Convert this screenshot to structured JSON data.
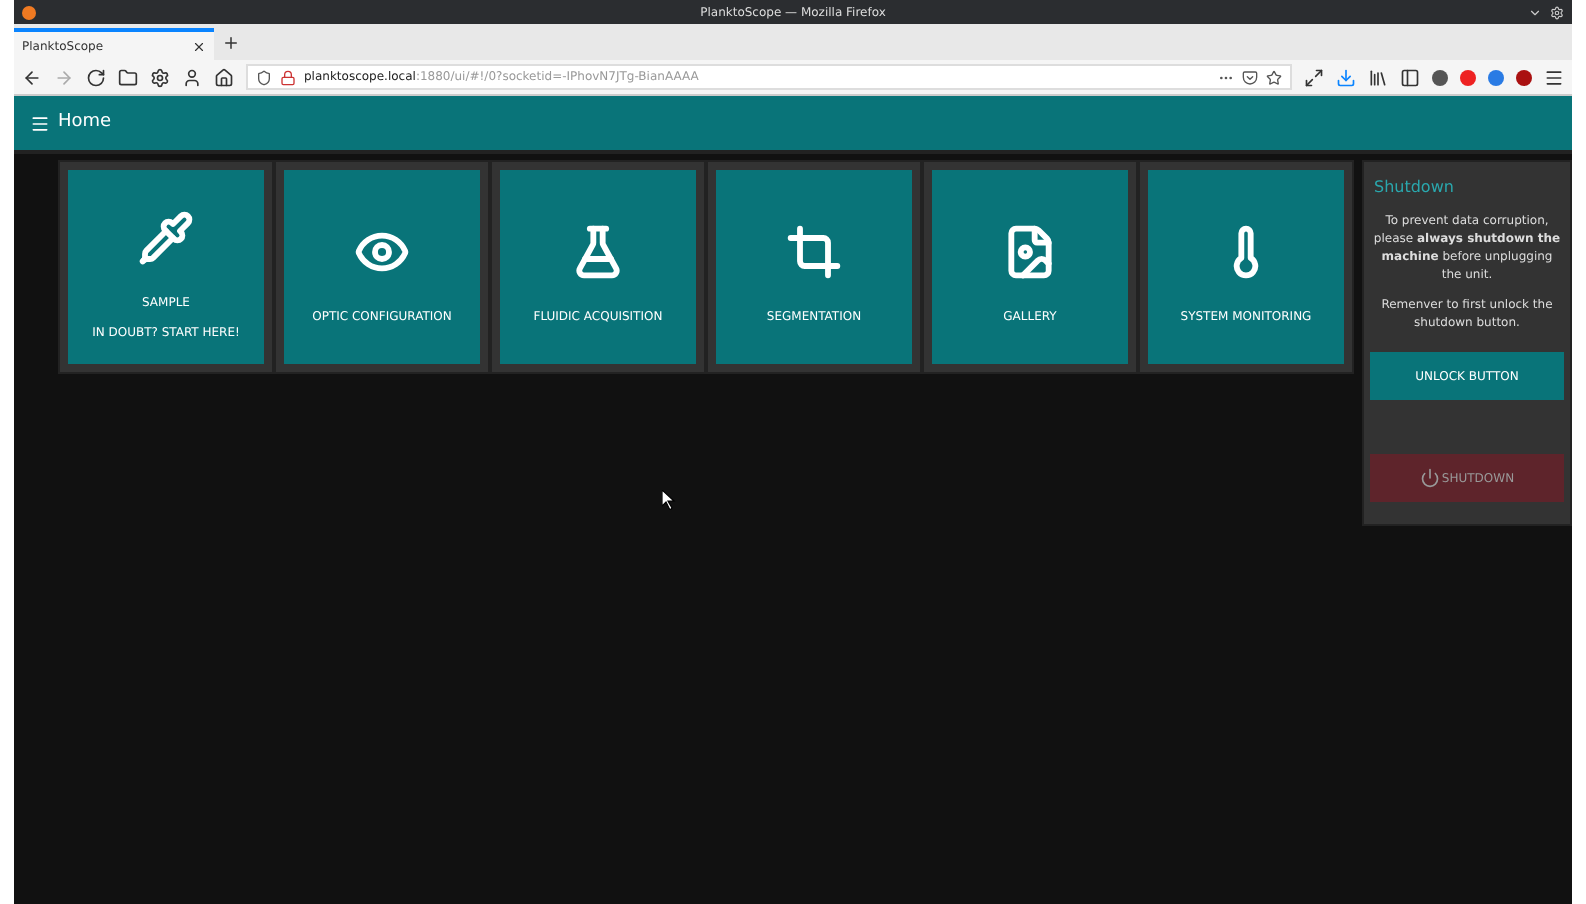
{
  "window": {
    "title": "PlanktoScope — Mozilla Firefox"
  },
  "tab": {
    "title": "PlanktoScope",
    "selected": true
  },
  "address_bar": {
    "host": "planktoscope.local",
    "path": ":1880/ui/#!/0?socketid=-IPhovN7JTg-BianAAAA"
  },
  "header": {
    "title": "Home"
  },
  "tiles": [
    {
      "label": "SAMPLE",
      "sublabel": "IN DOUBT? START HERE!"
    },
    {
      "label": "OPTIC CONFIGURATION"
    },
    {
      "label": "FLUIDIC ACQUISITION"
    },
    {
      "label": "SEGMENTATION"
    },
    {
      "label": "GALLERY"
    },
    {
      "label": "SYSTEM MONITORING"
    }
  ],
  "shutdown_panel": {
    "title": "Shutdown",
    "message": "To prevent data corruption, please **always shutdown the machine** before unplugging the unit.",
    "reminder": "Remenver to first unlock the shutdown button.",
    "unlock_button": "UNLOCK BUTTON",
    "shutdown_button": {
      "label": "SHUTDOWN",
      "disabled": true
    }
  }
}
